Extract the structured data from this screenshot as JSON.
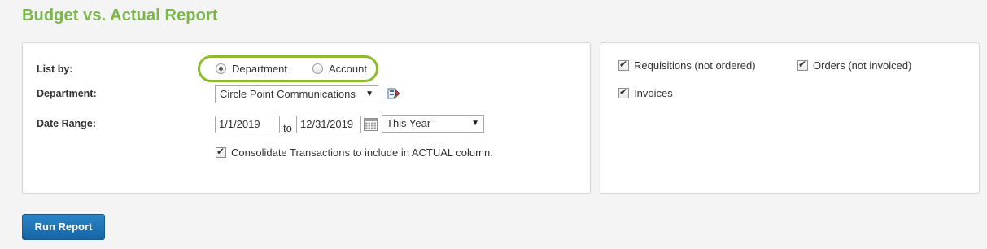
{
  "page": {
    "title": "Budget vs. Actual Report"
  },
  "filters": {
    "list_by": {
      "label": "List by:",
      "options": [
        {
          "label": "Department",
          "selected": true
        },
        {
          "label": "Account",
          "selected": false
        }
      ]
    },
    "department": {
      "label": "Department:",
      "value": "Circle Point Communications",
      "icon": "department-picker-icon"
    },
    "date_range": {
      "label": "Date Range:",
      "from": "1/1/2019",
      "to_text": "to",
      "to": "12/31/2019",
      "preset": "This Year",
      "calendar_icon": "calendar-icon"
    },
    "consolidate": {
      "label": "Consolidate Transactions to include in ACTUAL column.",
      "checked": true
    }
  },
  "include": {
    "requisitions": {
      "label": "Requisitions (not ordered)",
      "checked": true
    },
    "orders": {
      "label": "Orders (not invoiced)",
      "checked": true
    },
    "invoices": {
      "label": "Invoices",
      "checked": true
    }
  },
  "actions": {
    "run_report": "Run Report"
  },
  "colors": {
    "title": "#7ab648",
    "highlight": "#8cbb2b",
    "button": "#1b6fb3"
  }
}
